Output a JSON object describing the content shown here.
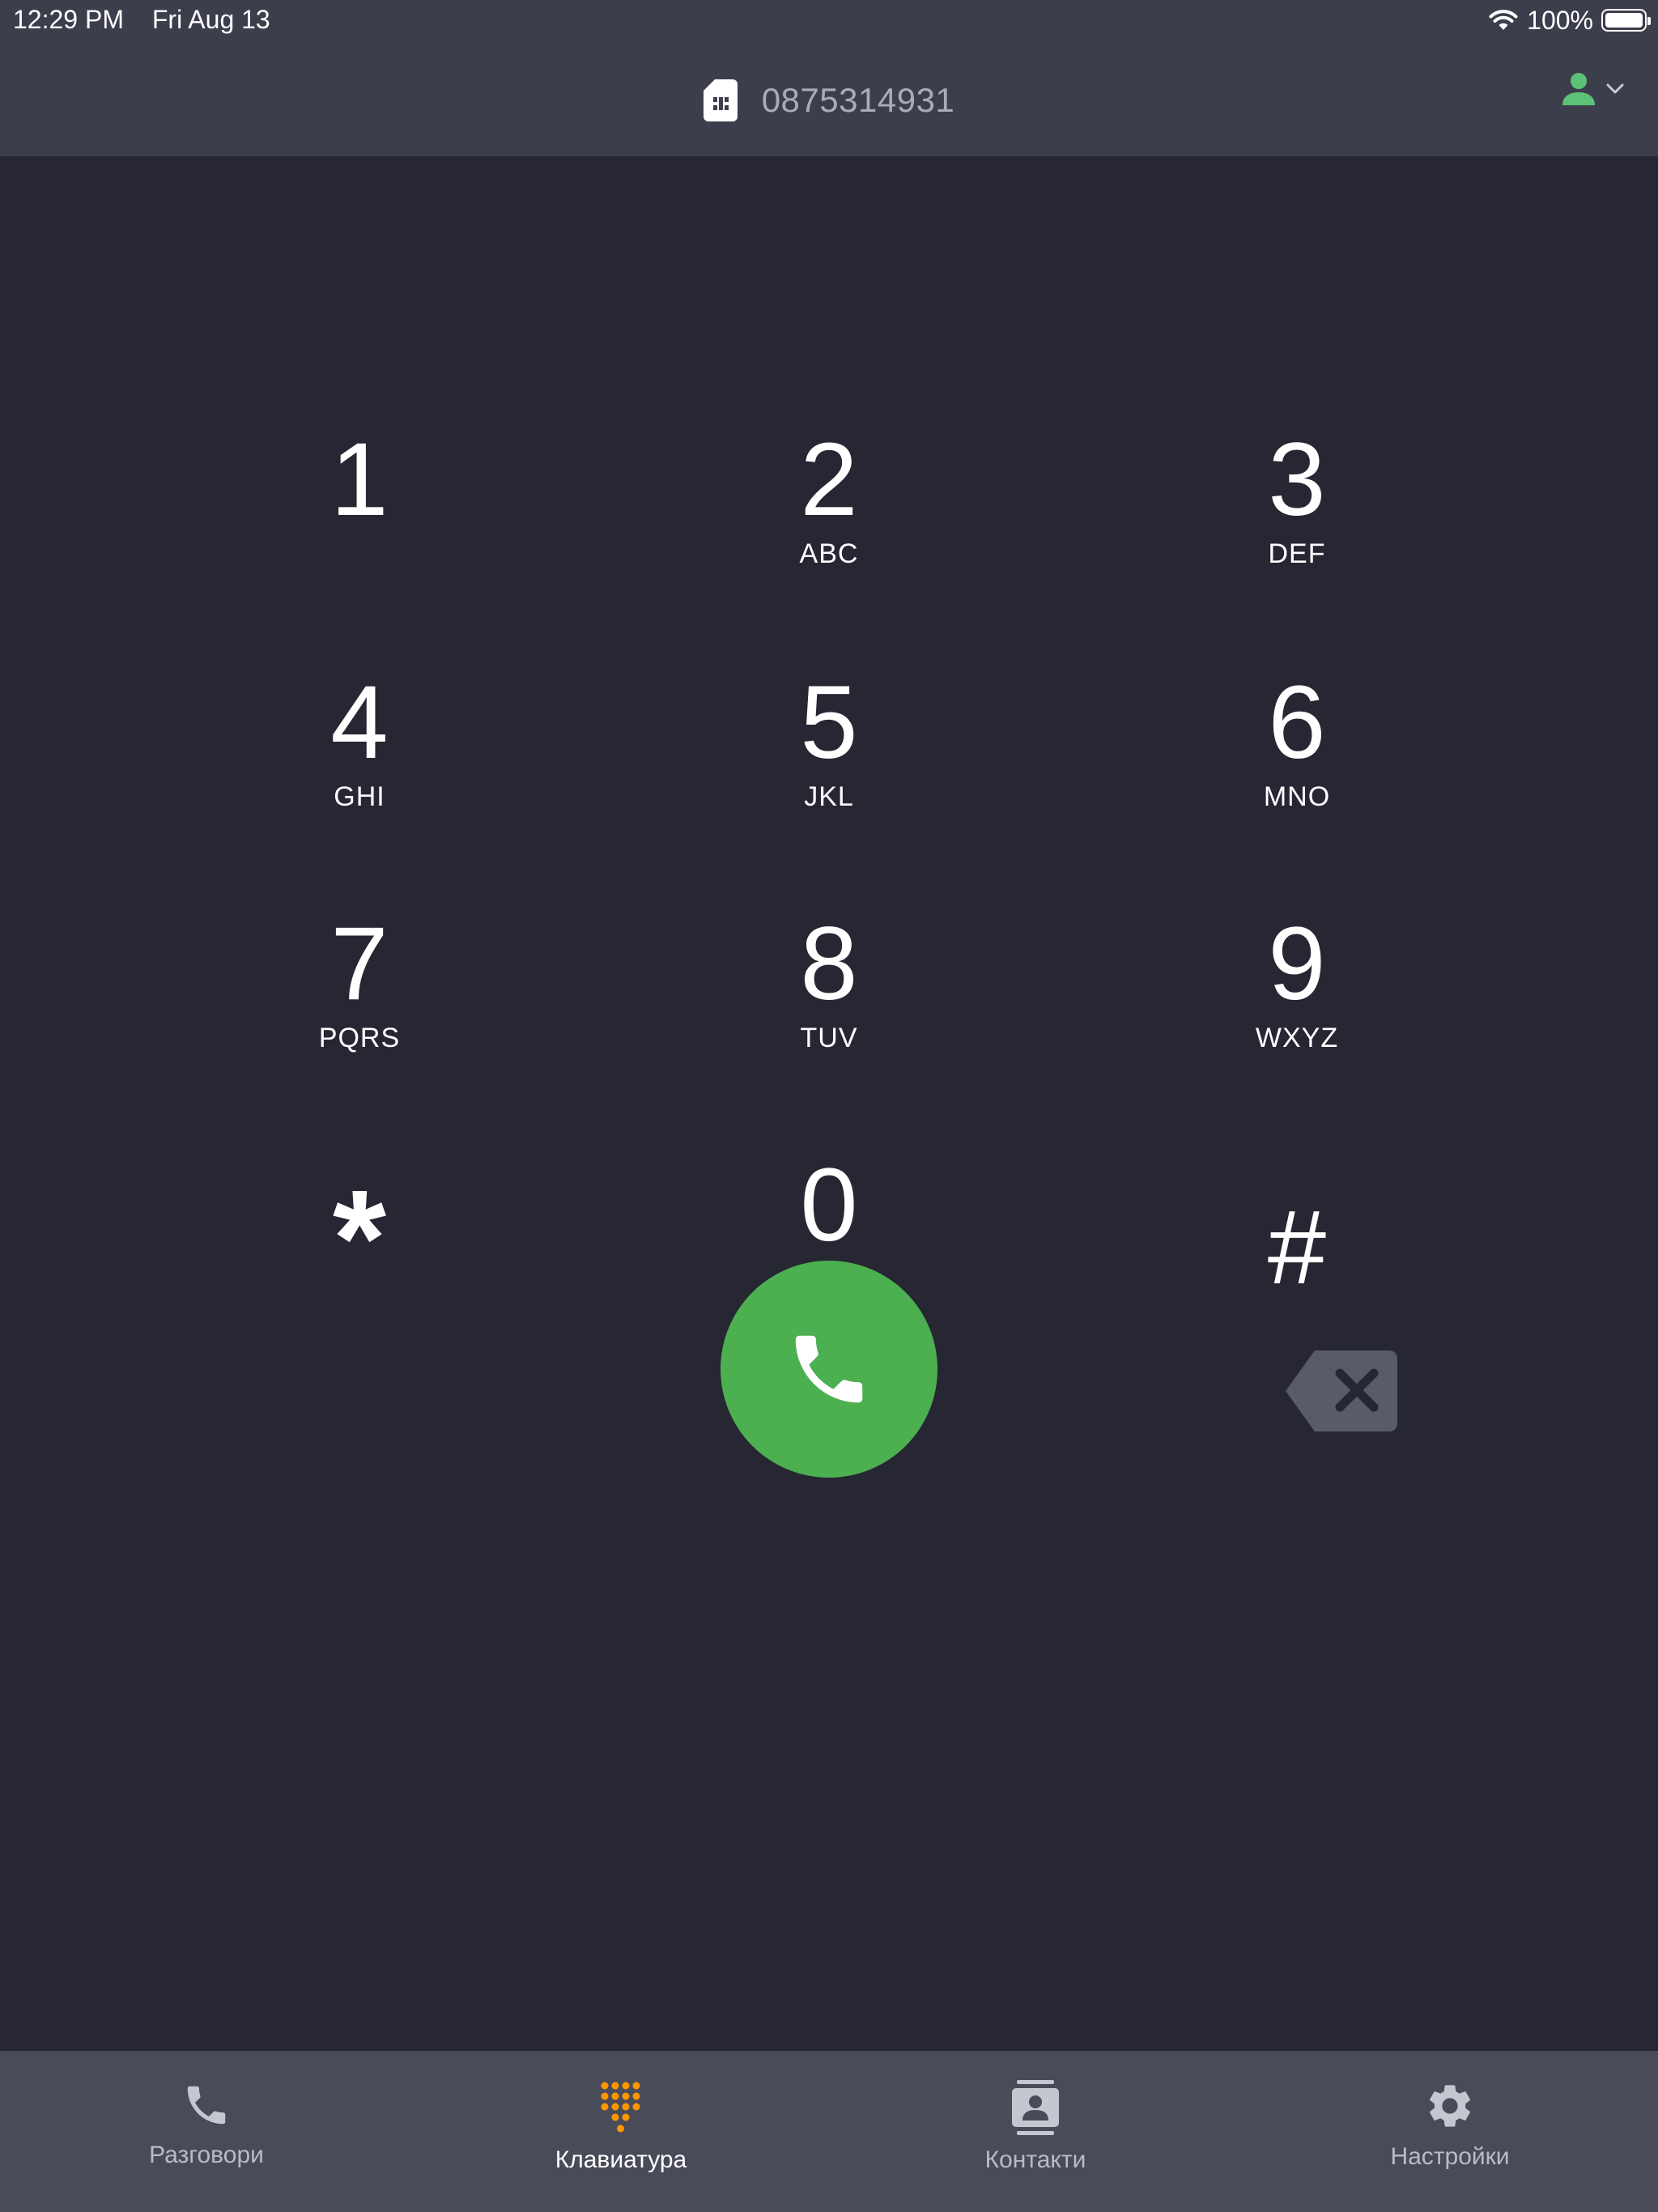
{
  "status_bar": {
    "time": "12:29 PM",
    "date": "Fri Aug 13",
    "battery": "100%",
    "battery_level": 1.0
  },
  "header": {
    "phone_number": "0875314931",
    "sim_icon": "sim-card-icon",
    "account_icon": "person-icon"
  },
  "keypad": {
    "keys": [
      {
        "digit": "1",
        "letters": ""
      },
      {
        "digit": "2",
        "letters": "ABC"
      },
      {
        "digit": "3",
        "letters": "DEF"
      },
      {
        "digit": "4",
        "letters": "GHI"
      },
      {
        "digit": "5",
        "letters": "JKL"
      },
      {
        "digit": "6",
        "letters": "MNO"
      },
      {
        "digit": "7",
        "letters": "PQRS"
      },
      {
        "digit": "8",
        "letters": "TUV"
      },
      {
        "digit": "9",
        "letters": "WXYZ"
      },
      {
        "digit": "*",
        "letters": ""
      },
      {
        "digit": "0",
        "letters": "+"
      },
      {
        "digit": "#",
        "letters": ""
      }
    ]
  },
  "actions": {
    "call_icon": "phone-icon",
    "backspace_icon": "backspace-icon"
  },
  "tabs": [
    {
      "label": "Разговори",
      "icon": "phone-icon",
      "active": false
    },
    {
      "label": "Клавиатура",
      "icon": "dialpad-icon",
      "active": true
    },
    {
      "label": "Контакти",
      "icon": "contacts-icon",
      "active": false
    },
    {
      "label": "Настройки",
      "icon": "gear-icon",
      "active": false
    }
  ],
  "colors": {
    "background": "#262733",
    "header": "#3d3e4c",
    "tab_bar": "#4a4b59",
    "call_green": "#4caf50",
    "accent_orange": "#ff9800",
    "account_green": "#5cc277"
  }
}
